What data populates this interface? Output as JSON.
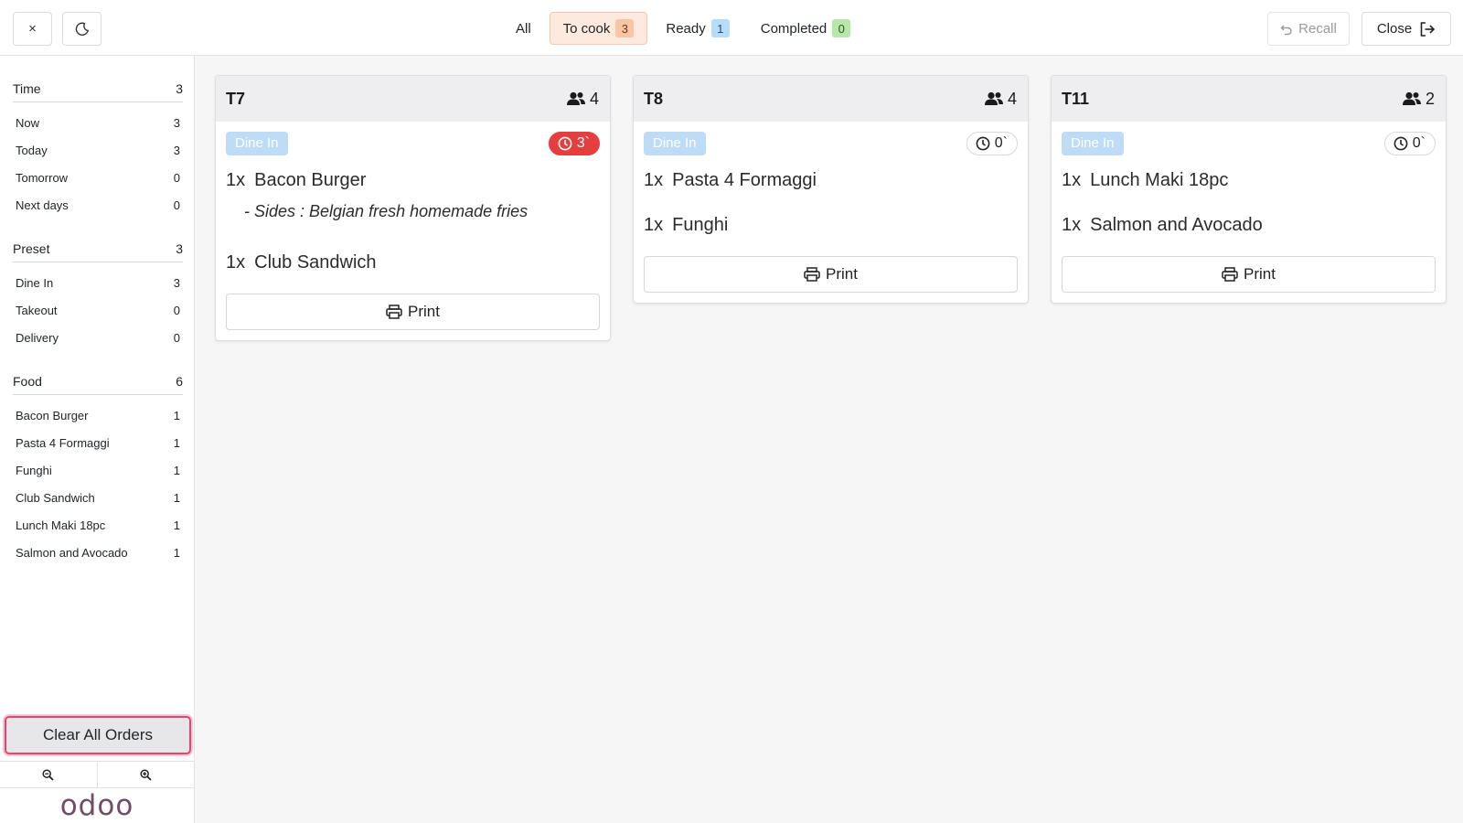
{
  "topbar": {
    "close_x": "×",
    "tabs": [
      {
        "label": "All",
        "count": null
      },
      {
        "label": "To cook",
        "count": "3",
        "color": "#f9c5a4"
      },
      {
        "label": "Ready",
        "count": "1",
        "color": "#b7dcfa"
      },
      {
        "label": "Completed",
        "count": "0",
        "color": "#b9e6a9"
      }
    ],
    "recall_label": "Recall",
    "close_label": "Close"
  },
  "sidebar": {
    "sections": [
      {
        "title": "Time",
        "count": "3",
        "items": [
          {
            "label": "Now",
            "count": "3"
          },
          {
            "label": "Today",
            "count": "3"
          },
          {
            "label": "Tomorrow",
            "count": "0"
          },
          {
            "label": "Next days",
            "count": "0"
          }
        ]
      },
      {
        "title": "Preset",
        "count": "3",
        "items": [
          {
            "label": "Dine In",
            "count": "3"
          },
          {
            "label": "Takeout",
            "count": "0"
          },
          {
            "label": "Delivery",
            "count": "0"
          }
        ]
      },
      {
        "title": "Food",
        "count": "6",
        "items": [
          {
            "label": "Bacon Burger",
            "count": "1"
          },
          {
            "label": "Pasta 4 Formaggi",
            "count": "1"
          },
          {
            "label": "Funghi",
            "count": "1"
          },
          {
            "label": "Club Sandwich",
            "count": "1"
          },
          {
            "label": "Lunch Maki 18pc",
            "count": "1"
          },
          {
            "label": "Salmon and Avocado",
            "count": "1"
          }
        ]
      }
    ],
    "clear_label": "Clear All Orders",
    "logo": "odoo"
  },
  "orders": [
    {
      "table": "T7",
      "guests": "4",
      "preset": "Dine In",
      "timer": "3`",
      "late": true,
      "lines": [
        {
          "qty": "1x",
          "name": "Bacon Burger",
          "attr": "- Sides : Belgian fresh homemade fries"
        },
        {
          "qty": "1x",
          "name": "Club Sandwich",
          "attr": null
        }
      ],
      "print_label": "Print"
    },
    {
      "table": "T8",
      "guests": "4",
      "preset": "Dine In",
      "timer": "0`",
      "late": false,
      "lines": [
        {
          "qty": "1x",
          "name": "Pasta 4 Formaggi",
          "attr": null
        },
        {
          "qty": "1x",
          "name": "Funghi",
          "attr": null
        }
      ],
      "print_label": "Print"
    },
    {
      "table": "T11",
      "guests": "2",
      "preset": "Dine In",
      "timer": "0`",
      "late": false,
      "lines": [
        {
          "qty": "1x",
          "name": "Lunch Maki 18pc",
          "attr": null
        },
        {
          "qty": "1x",
          "name": "Salmon and Avocado",
          "attr": null
        }
      ],
      "print_label": "Print"
    }
  ],
  "colors": {
    "accent": "#e0476f",
    "late_timer": "#e53e3e",
    "dine_tag": "#bfdcf6",
    "brand": "#714b67"
  }
}
